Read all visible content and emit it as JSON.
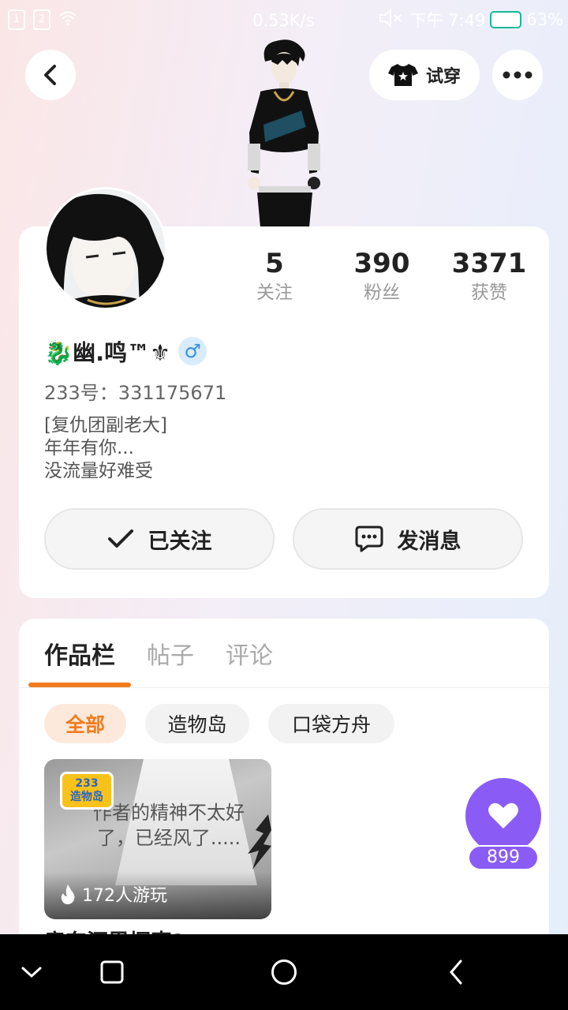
{
  "status_bar": {
    "sim1": "1",
    "sim2": "2",
    "speed": "0.53K/s",
    "time": "下午 7:49",
    "battery": "63%"
  },
  "header": {
    "try_on_label": "试穿"
  },
  "profile": {
    "stats": [
      {
        "value": "5",
        "label": "关注"
      },
      {
        "value": "390",
        "label": "粉丝"
      },
      {
        "value": "3371",
        "label": "获赞"
      }
    ],
    "name": "🐉幽.鸣™⚜",
    "gender_symbol": "♂",
    "uid": "233号：331175671",
    "bio_lines": [
      "[复仇团副老大]",
      "年年有你...",
      "没流量好难受"
    ]
  },
  "actions": {
    "follow_label": "已关注",
    "message_label": "发消息"
  },
  "tabs": [
    {
      "label": "作品栏",
      "active": true
    },
    {
      "label": "帖子",
      "active": false
    },
    {
      "label": "评论",
      "active": false
    }
  ],
  "filters": [
    {
      "label": "全部",
      "active": true
    },
    {
      "label": "造物岛",
      "active": false
    },
    {
      "label": "口袋方舟",
      "active": false
    }
  ],
  "game": {
    "logo_top": "233",
    "logo_bottom": "造物岛",
    "overlay_text": "作者的精神不太好了，已经风了.....",
    "plays": "172人游玩",
    "title": "房东沉思探索?"
  },
  "like": {
    "count": "899"
  },
  "colors": {
    "accent_orange": "#f27b1d",
    "like_purple": "#8a5cf5"
  }
}
